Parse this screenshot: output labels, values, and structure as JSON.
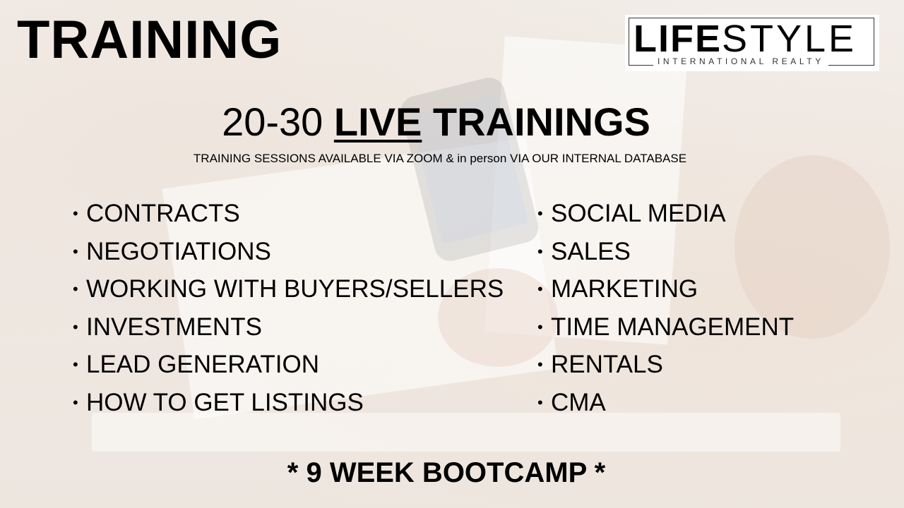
{
  "title": "TRAINING",
  "logo": {
    "main_bold": "LIFE",
    "main_light": "STYLE",
    "sub": "INTERNATIONAL REALTY"
  },
  "headline": {
    "prefix": "20-30 ",
    "emphasis": "LIVE",
    "suffix": " TRAININGS"
  },
  "subhead": "TRAINING SESSIONS AVAILABLE VIA ZOOM & in person VIA OUR INTERNAL DATABASE",
  "bullet_glyph": "•",
  "topics_left": [
    "CONTRACTS",
    "NEGOTIATIONS",
    "WORKING WITH BUYERS/SELLERS",
    "INVESTMENTS",
    "LEAD GENERATION",
    "HOW TO GET LISTINGS"
  ],
  "topics_right": [
    "SOCIAL MEDIA",
    "SALES",
    "MARKETING",
    "TIME MANAGEMENT",
    "RENTALS",
    "CMA"
  ],
  "footer": "* 9 WEEK BOOTCAMP *"
}
